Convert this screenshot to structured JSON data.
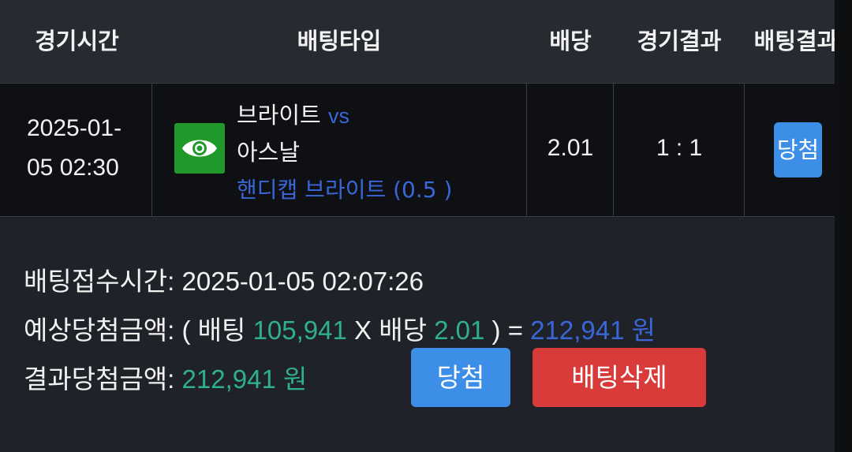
{
  "header": {
    "game_time": "경기시간",
    "bet_type": "배팅타입",
    "odds": "배당",
    "game_result": "경기결과",
    "bet_result": "배팅결과"
  },
  "row": {
    "date_line1": "2025-01-",
    "date_line2": "05 02:30",
    "home_team": "브라이트",
    "vs": "vs",
    "away_team": "아스날",
    "market": "핸디캡 브라이트 (0.5 )",
    "market_icon": "eye-icon",
    "odds": "2.01",
    "score": "1 : 1",
    "result_badge": "당첨"
  },
  "info": {
    "received_label": "배팅접수시간:",
    "received_value": "2025-01-05 02:07:26",
    "expected_label": "예상당첨금액:",
    "expected_open": "( 배팅",
    "bet_amount": "105,941",
    "times_odds": "X 배당",
    "odds": "2.01",
    "close_eq": ") =",
    "expected_amount": "212,941 원",
    "result_label": "결과당첨금액:",
    "result_amount": "212,941 원"
  },
  "buttons": {
    "win": "당첨",
    "delete": "배팅삭제"
  },
  "colors": {
    "accent_green": "#2fb08a",
    "accent_blue": "#3a67d8",
    "badge_blue": "#3d8ee6",
    "delete_red": "#d93a3a",
    "icon_green": "#1f9a2a"
  }
}
